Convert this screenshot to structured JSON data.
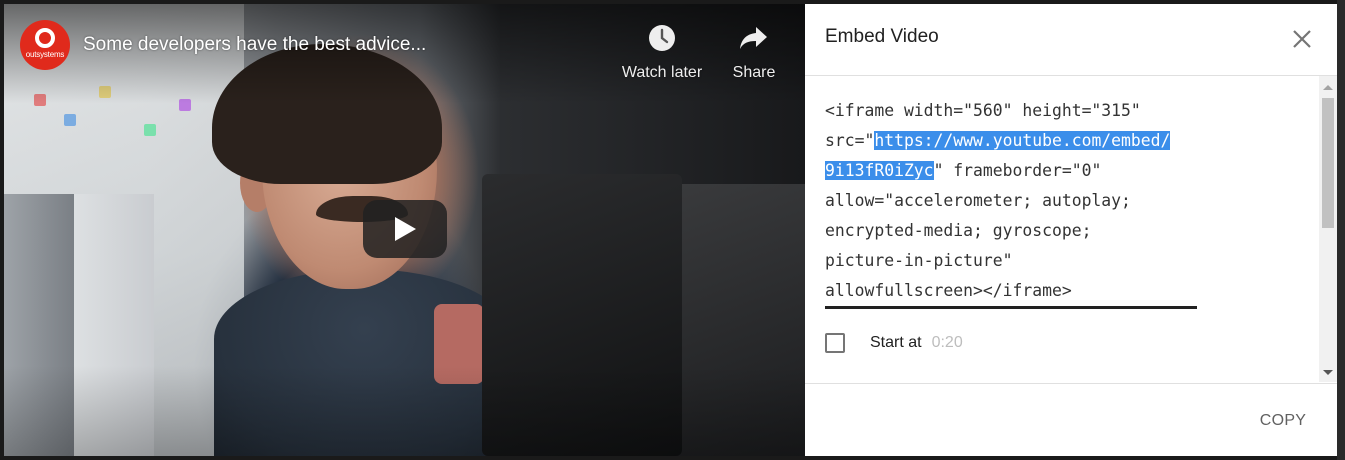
{
  "video": {
    "channel_logo_text": "outsystems",
    "title": "Some developers have the best advice...",
    "watch_later_label": "Watch later",
    "share_label": "Share"
  },
  "embed": {
    "title": "Embed Video",
    "code_lines": [
      {
        "pre": "<iframe width=\"560\" height=\"315\"",
        "hl": "",
        "post": ""
      },
      {
        "pre": "src=\"",
        "hl": "https://www.youtube.com/embed/",
        "post": ""
      },
      {
        "pre": "",
        "hl": "9i13fR0iZyc",
        "post": "\" frameborder=\"0\""
      },
      {
        "pre": "allow=\"accelerometer; autoplay;",
        "hl": "",
        "post": ""
      },
      {
        "pre": "encrypted-media; gyroscope;",
        "hl": "",
        "post": ""
      },
      {
        "pre": "picture-in-picture\"",
        "hl": "",
        "post": ""
      },
      {
        "pre": "allowfullscreen></iframe>",
        "hl": "",
        "post": ""
      }
    ],
    "start_at_label": "Start at",
    "start_at_time": "0:20",
    "start_at_checked": false,
    "copy_label": "COPY"
  },
  "colors": {
    "selection": "#3b8eea",
    "channel_logo": "#e02a1c"
  }
}
